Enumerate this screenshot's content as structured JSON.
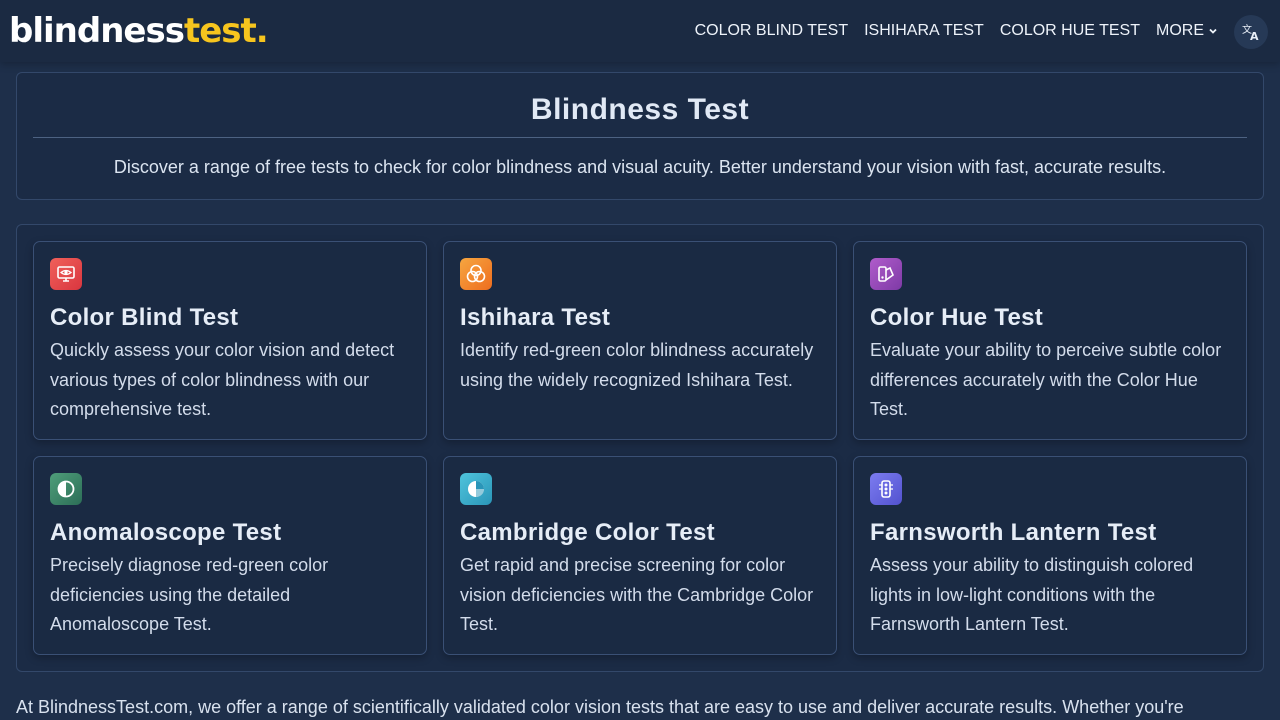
{
  "header": {
    "logo_part1": "blindness",
    "logo_part2": "test.",
    "nav": [
      {
        "label": "COLOR BLIND TEST"
      },
      {
        "label": "ISHIHARA TEST"
      },
      {
        "label": "COLOR HUE TEST"
      },
      {
        "label": "MORE"
      }
    ],
    "language_icon": "translate-icon"
  },
  "hero": {
    "title": "Blindness Test",
    "subtitle": "Discover a range of free tests to check for color blindness and visual acuity. Better understand your vision with fast, accurate results."
  },
  "cards": [
    {
      "title": "Color Blind Test",
      "description": "Quickly assess your color vision and detect various types of color blindness with our comprehensive test.",
      "icon": "monitor-eye-icon",
      "icon_colors": [
        "#f0605a",
        "#d9363f"
      ]
    },
    {
      "title": "Ishihara Test",
      "description": "Identify red-green color blindness accurately using the widely recognized Ishihara Test.",
      "icon": "circles-icon",
      "icon_colors": [
        "#f6a640",
        "#ee6d1f"
      ]
    },
    {
      "title": "Color Hue Test",
      "description": "Evaluate your ability to perceive subtle color differences accurately with the Color Hue Test.",
      "icon": "swatch-icon",
      "icon_colors": [
        "#b05ccb",
        "#7e3aa6"
      ]
    },
    {
      "title": "Anomaloscope Test",
      "description": "Precisely diagnose red-green color deficiencies using the detailed Anomaloscope Test.",
      "icon": "half-circle-icon",
      "icon_colors": [
        "#4f9e7a",
        "#2c6e57"
      ]
    },
    {
      "title": "Cambridge Color Test",
      "description": "Get rapid and precise screening for color vision deficiencies with the Cambridge Color Test.",
      "icon": "pie-icon",
      "icon_colors": [
        "#4fc4dc",
        "#2a95b8"
      ]
    },
    {
      "title": "Farnsworth Lantern Test",
      "description": "Assess your ability to distinguish colored lights in low-light conditions with the Farnsworth Lantern Test.",
      "icon": "traffic-light-icon",
      "icon_colors": [
        "#7c7cf0",
        "#5252cf"
      ]
    }
  ],
  "footer_text": "At BlindnessTest.com, we offer a range of scientifically validated color vision tests that are easy to use and deliver accurate results. Whether you're"
}
